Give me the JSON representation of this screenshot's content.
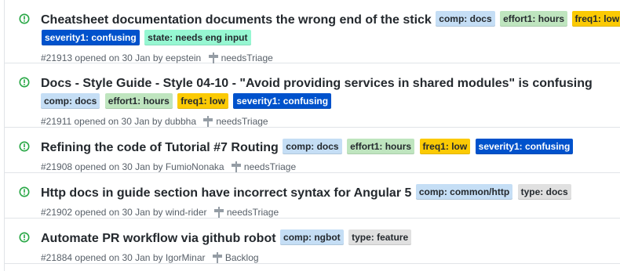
{
  "colors": {
    "open_icon": "#28a745",
    "comp": "#c5def5",
    "effort": "#bfe5bf",
    "freq": "#fbca04",
    "severity": "#0052cc",
    "state": "#96f7d2",
    "type": "#e0e0e0",
    "white_text": "#ffffff",
    "dark_text": "#24292e"
  },
  "issues": [
    {
      "title": "Cheatsheet documentation documents the wrong end of the stick",
      "labels": [
        {
          "text": "comp: docs",
          "kind": "comp"
        },
        {
          "text": "effort1: hours",
          "kind": "effort"
        },
        {
          "text": "freq1: low",
          "kind": "freq"
        },
        {
          "text": "severity1: confusing",
          "kind": "severity"
        },
        {
          "text": "state: needs eng input",
          "kind": "state"
        }
      ],
      "number": "#21913",
      "opened": "opened on 30 Jan by",
      "author": "eepstein",
      "milestone": "needsTriage"
    },
    {
      "title": "Docs - Style Guide - Style 04-10 - \"Avoid providing services in shared modules\" is confusing",
      "labels": [
        {
          "text": "comp: docs",
          "kind": "comp"
        },
        {
          "text": "effort1: hours",
          "kind": "effort"
        },
        {
          "text": "freq1: low",
          "kind": "freq"
        },
        {
          "text": "severity1: confusing",
          "kind": "severity"
        }
      ],
      "number": "#21911",
      "opened": "opened on 30 Jan by",
      "author": "dubbha",
      "milestone": "needsTriage"
    },
    {
      "title": "Refining the code of Tutorial #7 Routing",
      "labels": [
        {
          "text": "comp: docs",
          "kind": "comp"
        },
        {
          "text": "effort1: hours",
          "kind": "effort"
        },
        {
          "text": "freq1: low",
          "kind": "freq"
        },
        {
          "text": "severity1: confusing",
          "kind": "severity"
        }
      ],
      "number": "#21908",
      "opened": "opened on 30 Jan by",
      "author": "FumioNonaka",
      "milestone": "needsTriage"
    },
    {
      "title": "Http docs in guide section have incorrect syntax for Angular 5",
      "labels": [
        {
          "text": "comp: common/http",
          "kind": "comp"
        },
        {
          "text": "type: docs",
          "kind": "type"
        }
      ],
      "number": "#21902",
      "opened": "opened on 30 Jan by",
      "author": "wind-rider",
      "milestone": "needsTriage"
    },
    {
      "title": "Automate PR workflow via github robot",
      "labels": [
        {
          "text": "comp: ngbot",
          "kind": "comp"
        },
        {
          "text": "type: feature",
          "kind": "type"
        }
      ],
      "number": "#21884",
      "opened": "opened on 30 Jan by",
      "author": "IgorMinar",
      "milestone": "Backlog"
    }
  ]
}
